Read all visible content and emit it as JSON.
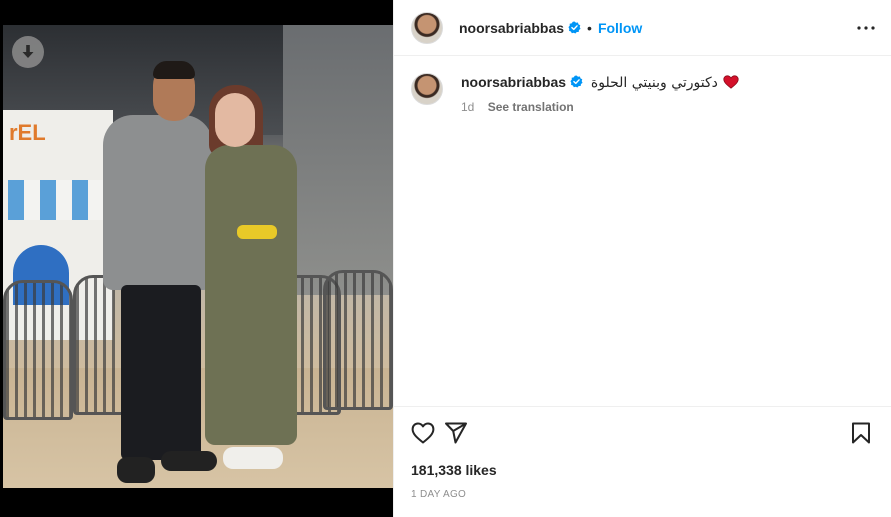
{
  "media": {
    "download_icon": "download-arrow-icon",
    "photo_alt": "",
    "shop_sign": "rEL"
  },
  "post_header": {
    "username": "noorsabriabbas",
    "verified_icon": "verified-badge-icon",
    "separator": "•",
    "follow_label": "Follow",
    "more_icon": "more-options-icon",
    "follow_color": "#0095f6",
    "verified_color": "#0095f6"
  },
  "caption_comment": {
    "username": "noorsabriabbas",
    "text": "دكتورتي وبنيتي الحلوة",
    "emoji_icon": "red-heart-icon",
    "age": "1d",
    "translation_label": "See translation"
  },
  "actions": {
    "like_icon": "heart-outline-icon",
    "share_icon": "paper-plane-icon",
    "save_icon": "bookmark-icon"
  },
  "likes": {
    "text": "181,338 likes"
  },
  "timestamp": {
    "text": "1 DAY AGO"
  }
}
